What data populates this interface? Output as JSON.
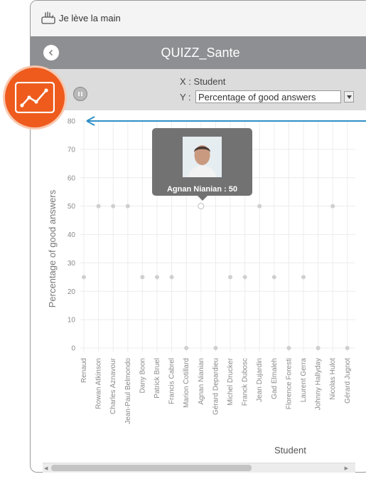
{
  "app": {
    "title": "Je lève la main"
  },
  "header": {
    "title": "QUIZZ_Sante"
  },
  "axes_selector": {
    "x_label": "X :",
    "x_value": "Student",
    "y_label": "Y :",
    "y_value": "Percentage of good answers"
  },
  "tooltip": {
    "text": "Agnan Nianian : 50"
  },
  "colors": {
    "header_bg": "#8e8f93",
    "badge": "#ee5b1d",
    "arrow": "#2f8fc6",
    "points": "#cfcfcf"
  },
  "chart_data": {
    "type": "scatter",
    "xlabel": "Student",
    "ylabel": "Percentage of good answers",
    "ylim": [
      0,
      80
    ],
    "y_ticks": [
      0,
      10,
      20,
      30,
      40,
      50,
      60,
      70,
      80
    ],
    "y_tick_labels": [
      "0",
      "10",
      "20",
      "30",
      "40",
      "50",
      "60",
      "70",
      "80"
    ],
    "grid": true,
    "categories": [
      "Renaud",
      "Rowan Atkinson",
      "Charles Aznavour",
      "Jean-Paul Belmondo",
      "Dany Boon",
      "Patrick Bruel",
      "Francis Cabrel",
      "Marion Cotillard",
      "Agnan Nianian",
      "Gérard Depardieu",
      "Michel Drucker",
      "Franck Dubosc",
      "Jean Dujardin",
      "Gad Elmaleh",
      "Florence Foresti",
      "Laurent Gerra",
      "Johnny Hallyday",
      "Nicolas Hulot",
      "Gérard Jugnot"
    ],
    "values": [
      25,
      50,
      50,
      50,
      25,
      25,
      25,
      0,
      50,
      0,
      25,
      25,
      50,
      25,
      0,
      25,
      0,
      50,
      0
    ]
  }
}
